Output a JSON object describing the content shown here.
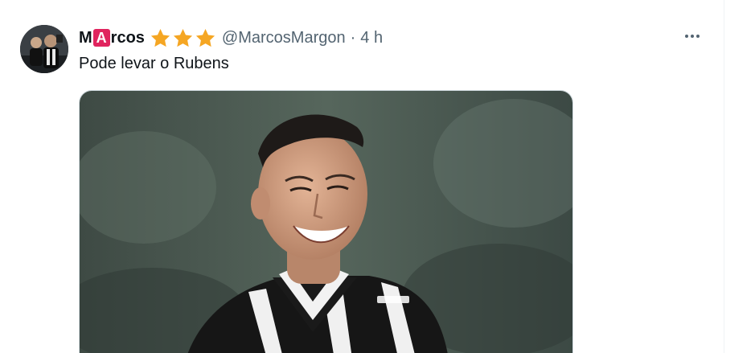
{
  "tweet": {
    "display_name_prefix": "M",
    "display_name_badge_letter": "A",
    "display_name_suffix": "rcos",
    "stars_count": 3,
    "star_color": "#f5a623",
    "handle": "@MarcosMargon",
    "separator": "·",
    "time": "4 h",
    "text": "Pode levar o Rubens",
    "more_icon": "more-horizontal-icon"
  },
  "colors": {
    "text_primary": "#0f1419",
    "text_secondary": "#536471",
    "badge_red": "#e0245e"
  }
}
